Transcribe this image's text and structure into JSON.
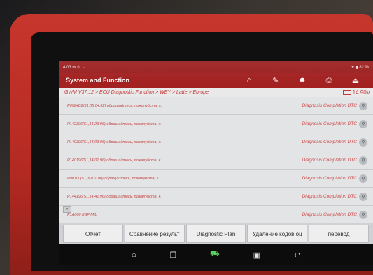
{
  "statusbar": {
    "left": "4:03 ✉ ⚙ ⚐",
    "right": "✦ ▮ 82 %"
  },
  "header": {
    "title": "System and Function"
  },
  "toolbar": [
    {
      "icon": "home-icon",
      "glyph": "⌂"
    },
    {
      "icon": "report-icon",
      "glyph": "✎"
    },
    {
      "icon": "user-icon",
      "glyph": "☻"
    },
    {
      "icon": "print-icon",
      "glyph": "⎙"
    },
    {
      "icon": "exit-icon",
      "glyph": "⏏"
    }
  ],
  "breadcrumb": "GWM V37.12 > ECU Diagnostic Function > WEY > Latte > Europe",
  "voltage": "14.90V",
  "rows": [
    {
      "code": "P0524B2(51,05,04,62) обращайтесь, пожалуйста, к.",
      "status": "Diagnosis Completion DTC"
    },
    {
      "code": "P142396(51,14,23,96) обращайтесь, пожалуйста, к.",
      "status": "Diagnosis Completion DTC"
    },
    {
      "code": "P140396(51,14,03,96) обращайтесь, пожалуйста, к.",
      "status": "Diagnosis Completion DTC"
    },
    {
      "code": "P140196(51,14,01,96) обращайтесь, пожалуйста, к.",
      "status": "Diagnosis Completion DTC"
    },
    {
      "code": "P00100(51,30,01,00) обращайтесь, пожалуйста, к.",
      "status": "Diagnosis Completion DTC"
    },
    {
      "code": "P144196(51,14,41,96) обращайтесь, пожалуйста, к.",
      "status": "Diagnosis Completion DTC"
    },
    {
      "code": "P1A000 ESP MIL",
      "status": "Diagnosis Completion DTC"
    }
  ],
  "buttons": [
    "Отчет",
    "Сравнение результ",
    "Diagnostic Plan",
    "Удаление кодов оц",
    "перевод"
  ],
  "nav": [
    {
      "icon": "home-nav-icon",
      "glyph": "⌂"
    },
    {
      "icon": "recents-icon",
      "glyph": "❐"
    },
    {
      "icon": "vci-icon",
      "glyph": "⛟"
    },
    {
      "icon": "screenshot-icon",
      "glyph": "▣"
    },
    {
      "icon": "back-icon",
      "glyph": "↩"
    }
  ]
}
